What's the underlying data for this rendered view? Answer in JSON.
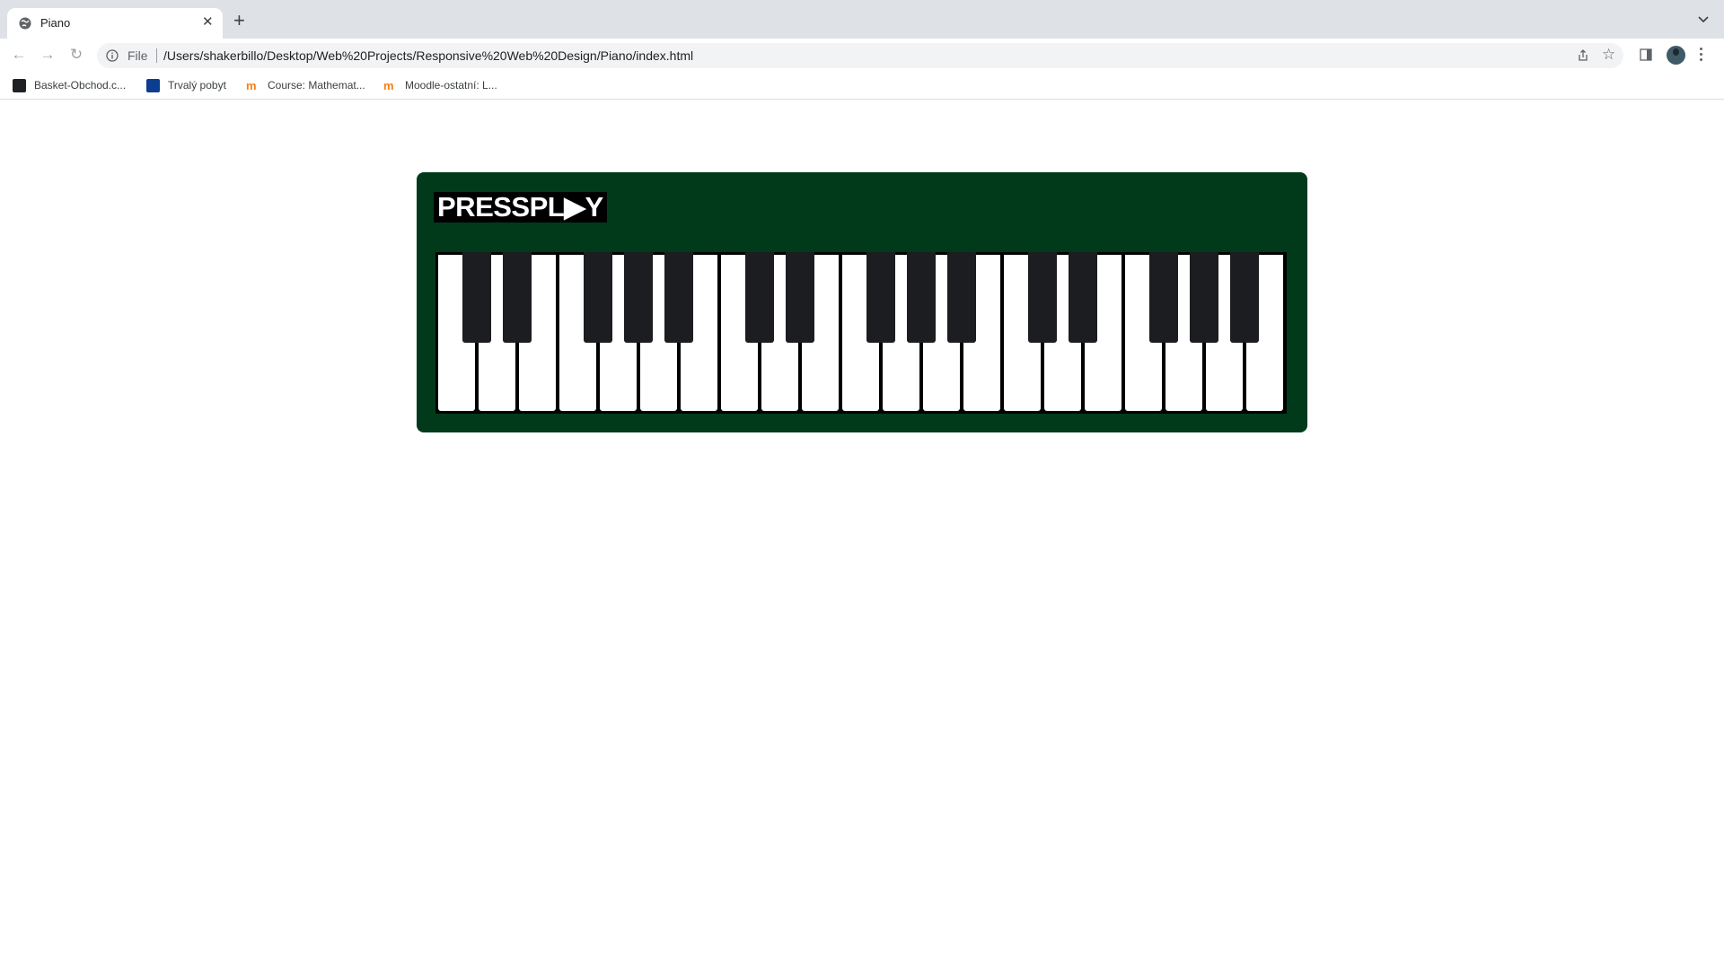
{
  "browser": {
    "tab": {
      "title": "Piano"
    },
    "address": {
      "scheme_label": "File",
      "url": "/Users/shakerbillo/Desktop/Web%20Projects/Responsive%20Web%20Design/Piano/index.html"
    },
    "bookmarks": [
      {
        "label": "Basket-Obchod.c...",
        "icon": "basket-favicon",
        "color": "#202124"
      },
      {
        "label": "Trvalý pobyt",
        "icon": "mvcr-favicon",
        "color": "#0b3d91"
      },
      {
        "label": "Course: Mathemat...",
        "icon": "moodle-favicon",
        "color": "#f98012"
      },
      {
        "label": "Moodle-ostatní: L...",
        "icon": "moodle-favicon",
        "color": "#f98012"
      }
    ]
  },
  "piano": {
    "logo": {
      "text": "PRESSPLAY",
      "display": "PRESSPL▶Y"
    },
    "background_color": "#013a1a",
    "white_key_count": 21,
    "black_key_color": "#1c1d20",
    "black_keys_after_white_index": [
      0,
      1,
      3,
      4,
      5,
      7,
      8,
      10,
      11,
      12,
      14,
      15,
      17,
      18,
      19
    ]
  }
}
